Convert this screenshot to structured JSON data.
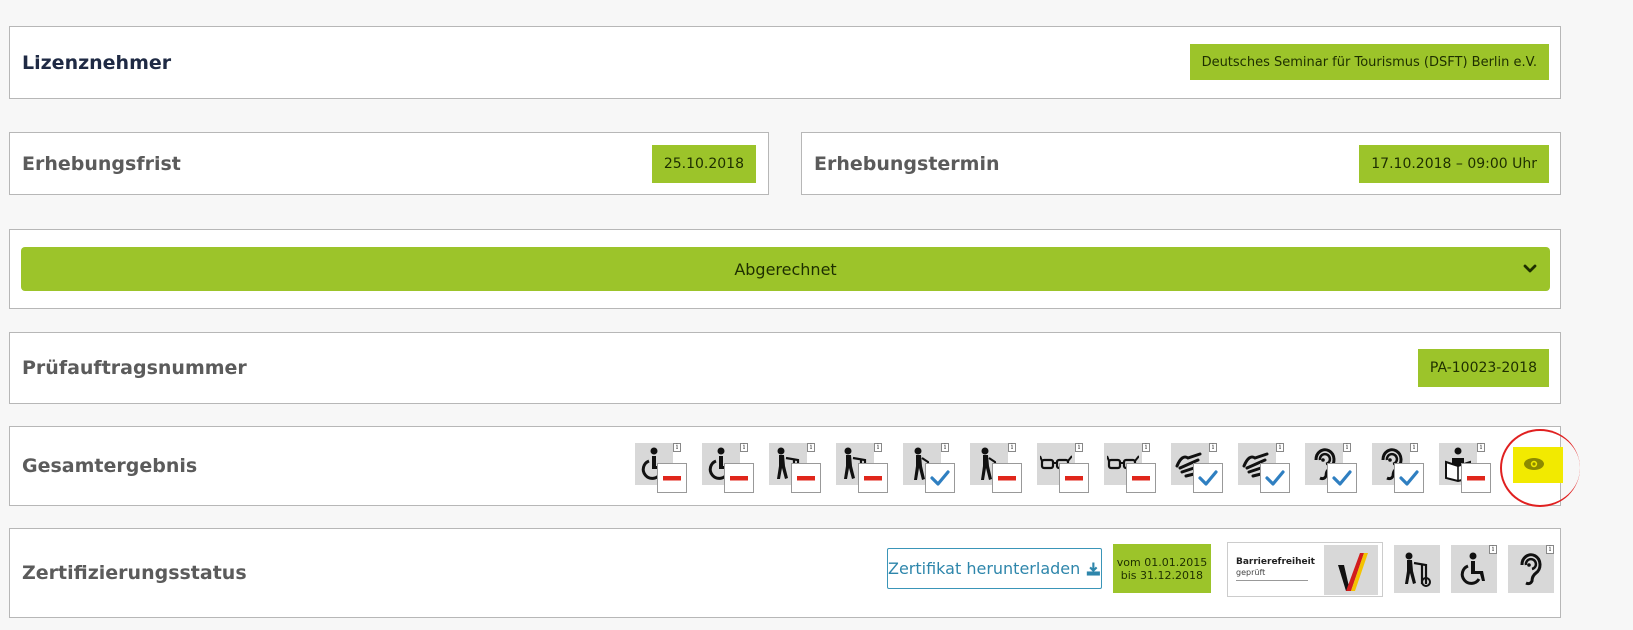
{
  "licensee": {
    "label": "Lizenznehmer",
    "value": "Deutsches Seminar für Tourismus (DSFT) Berlin e.V."
  },
  "survey_deadline": {
    "label": "Erhebungsfrist",
    "value": "25.10.2018"
  },
  "survey_date": {
    "label": "Erhebungstermin",
    "value": "17.10.2018 – 09:00 Uhr"
  },
  "status": {
    "label": "Abgerechnet"
  },
  "order_number": {
    "label": "Prüfauftragsnummer",
    "value": "PA-10023-2018"
  },
  "overall_result": {
    "label": "Gesamtergebnis",
    "tiles": [
      {
        "icon": "wheelchair-icon",
        "result": "fail"
      },
      {
        "icon": "wheelchair-icon",
        "result": "fail"
      },
      {
        "icon": "walker-icon",
        "result": "fail"
      },
      {
        "icon": "walker-icon",
        "result": "fail"
      },
      {
        "icon": "walking-cane-icon",
        "result": "pass"
      },
      {
        "icon": "walking-cane-icon",
        "result": "fail"
      },
      {
        "icon": "glasses-icon",
        "result": "fail"
      },
      {
        "icon": "glasses-icon",
        "result": "fail"
      },
      {
        "icon": "sign-language-icon",
        "result": "pass"
      },
      {
        "icon": "sign-language-icon",
        "result": "pass"
      },
      {
        "icon": "hearing-icon",
        "result": "pass"
      },
      {
        "icon": "hearing-icon",
        "result": "pass"
      },
      {
        "icon": "reading-person-icon",
        "result": "fail"
      }
    ],
    "colors": {
      "pass": "#2f7fc1",
      "fail": "#e0261b"
    }
  },
  "certification": {
    "label": "Zertifizierungsstatus",
    "download_label": "Zertifikat herunterladen",
    "valid_from": "vom 01.01.2015",
    "valid_to": "bis 31.12.2018",
    "badge_title": "Barrierefreiheit",
    "badge_sub": "geprüft"
  },
  "colors": {
    "accent": "#9cc42a",
    "link": "#2e86ab",
    "highlight": "#f2ea00",
    "annotation": "#e02020"
  }
}
